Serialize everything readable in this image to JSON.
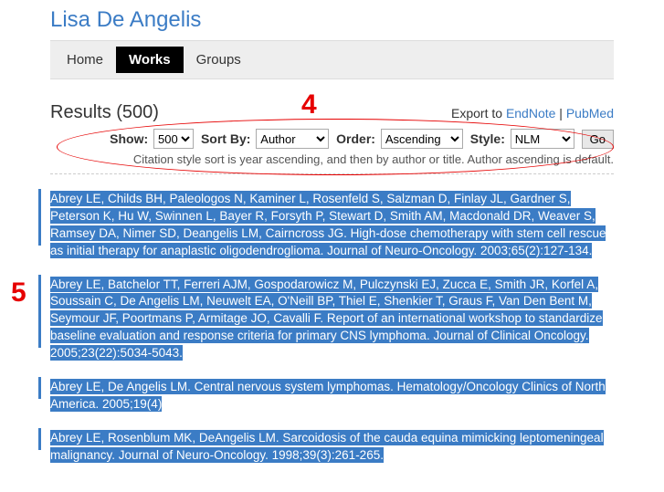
{
  "title": "Lisa De Angelis",
  "nav": {
    "home": "Home",
    "works": "Works",
    "groups": "Groups"
  },
  "results": {
    "heading": "Results (500)",
    "export_prefix": "Export to ",
    "endnote": "EndNote",
    "sep": " | ",
    "pubmed": "PubMed"
  },
  "controls": {
    "show_label": "Show:",
    "show_value": "500",
    "sort_label": "Sort By:",
    "sort_value": "Author",
    "order_label": "Order:",
    "order_value": "Ascending",
    "style_label": "Style:",
    "style_value": "NLM",
    "go": "Go"
  },
  "note": "Citation style sort is year ascending, and then by author or title. Author ascending is default.",
  "citations": [
    "Abrey LE, Childs BH, Paleologos N, Kaminer L, Rosenfeld S, Salzman D, Finlay JL, Gardner S, Peterson K, Hu W, Swinnen L, Bayer R, Forsyth P, Stewart D, Smith AM, Macdonald DR, Weaver S, Ramsey DA, Nimer SD, Deangelis LM, Cairncross JG. High-dose chemotherapy with stem cell rescue as initial therapy for anaplastic oligodendroglioma. Journal of Neuro-Oncology. 2003;65(2):127-134.",
    "Abrey LE, Batchelor TT, Ferreri AJM, Gospodarowicz M, Pulczynski EJ, Zucca E, Smith JR, Korfel A, Soussain C, De Angelis LM, Neuwelt EA, O'Neill BP, Thiel E, Shenkier T, Graus F, Van Den Bent M, Seymour JF, Poortmans P, Armitage JO, Cavalli F. Report of an international workshop to standardize baseline evaluation and response criteria for primary CNS lymphoma. Journal of Clinical Oncology. 2005;23(22):5034-5043.",
    "Abrey LE, De Angelis LM. Central nervous system lymphomas. Hematology/Oncology Clinics of North America. 2005;19(4)",
    "Abrey LE, Rosenblum MK, DeAngelis LM. Sarcoidosis of the cauda equina mimicking leptomeningeal malignancy. Journal of Neuro-Oncology. 1998;39(3):261-265."
  ],
  "annotations": {
    "four": "4",
    "five": "5"
  }
}
